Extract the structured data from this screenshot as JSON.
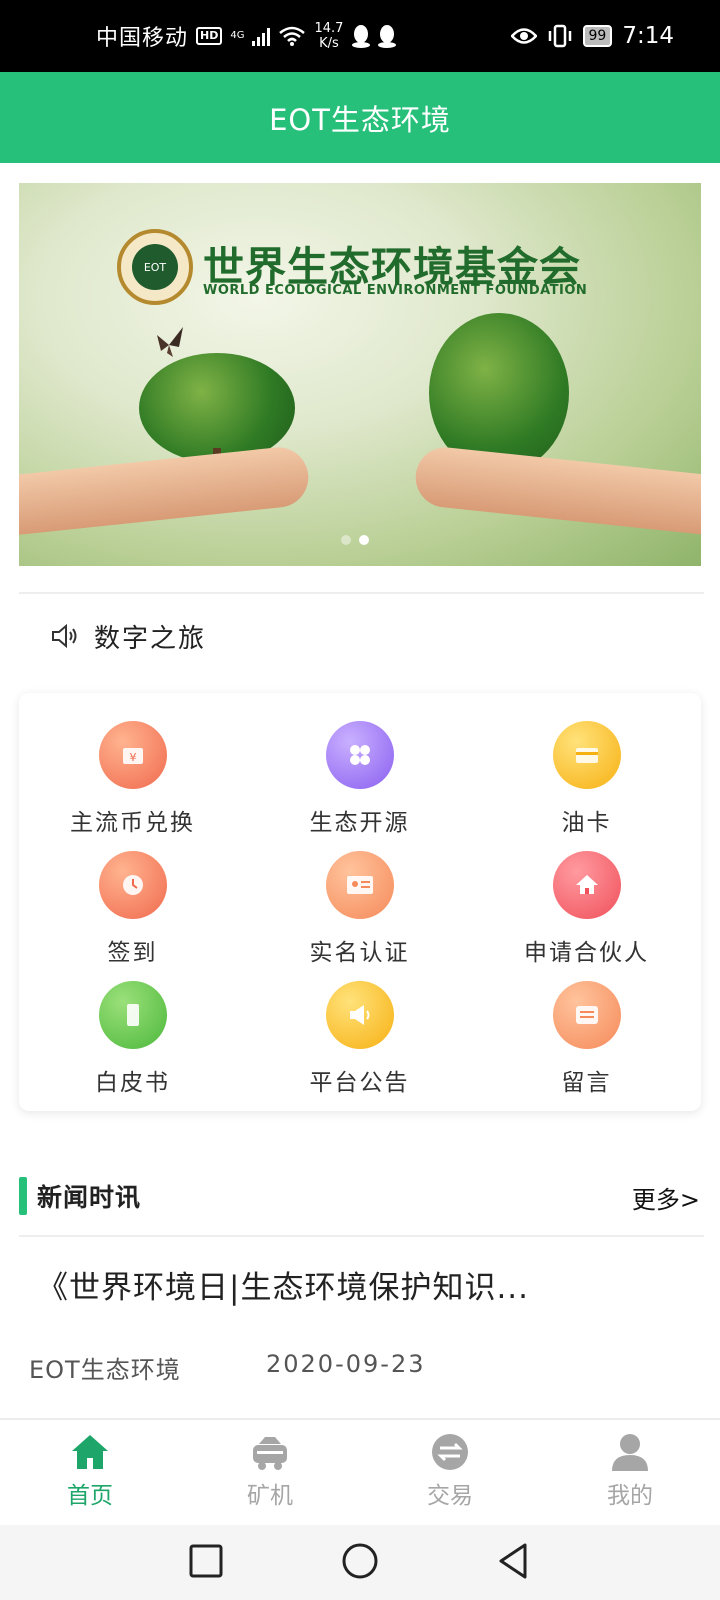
{
  "status_bar": {
    "carrier": "中国移动",
    "hd_badge": "HD",
    "network": "4G",
    "speed_value": "14.7",
    "speed_unit": "K/s",
    "battery": "99",
    "time": "7:14"
  },
  "app_bar": {
    "title": "EOT生态环境"
  },
  "banner": {
    "title_cn": "世界生态环境基金会",
    "title_en": "WORLD ECOLOGICAL ENVIRONMENT FOUNDATION",
    "logo_text": "EOT",
    "slide_count": 2,
    "active_slide": 2
  },
  "notice": {
    "icon": "speaker-icon",
    "text": "数字之旅"
  },
  "grid": {
    "items": [
      {
        "label": "主流币兑换",
        "icon": "exchange-icon",
        "color": "#f06a4e"
      },
      {
        "label": "生态开源",
        "icon": "clover-icon",
        "color": "#8a5ff0"
      },
      {
        "label": "油卡",
        "icon": "card-icon",
        "color": "#f7b012"
      },
      {
        "label": "签到",
        "icon": "clock-icon",
        "color": "#f06a4e"
      },
      {
        "label": "实名认证",
        "icon": "id-card-icon",
        "color": "#f58a5a"
      },
      {
        "label": "申请合伙人",
        "icon": "home-icon",
        "color": "#f0505a"
      },
      {
        "label": "白皮书",
        "icon": "phone-icon",
        "color": "#4cb83a"
      },
      {
        "label": "平台公告",
        "icon": "megaphone-icon",
        "color": "#f7b012"
      },
      {
        "label": "留言",
        "icon": "message-icon",
        "color": "#f58a5a"
      }
    ]
  },
  "news": {
    "section_title": "新闻时讯",
    "more_label": "更多>",
    "items": [
      {
        "title": "《世界环境日|生态环境保护知识...",
        "source": "EOT生态环境",
        "date": "2020-09-23"
      }
    ]
  },
  "tab_bar": {
    "active_color": "#1ea66a",
    "tabs": [
      {
        "label": "首页",
        "icon": "home-icon",
        "active": true
      },
      {
        "label": "矿机",
        "icon": "miner-icon",
        "active": false
      },
      {
        "label": "交易",
        "icon": "swap-icon",
        "active": false
      },
      {
        "label": "我的",
        "icon": "user-icon",
        "active": false
      }
    ]
  },
  "nav_bar": {
    "buttons": [
      "recent-apps",
      "home",
      "back"
    ]
  }
}
